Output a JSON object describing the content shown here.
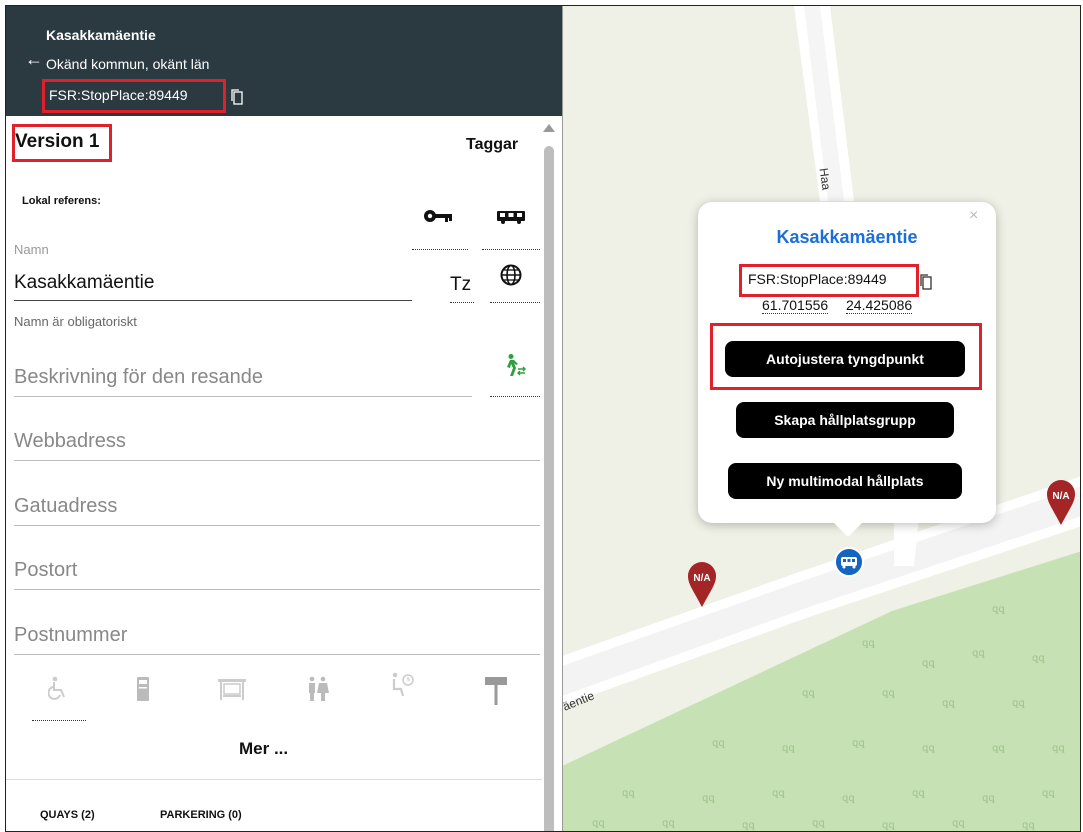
{
  "header": {
    "title": "Kasakkamäentie",
    "subtitle": "Okänd kommun, okänt län",
    "stop_id": "FSR:StopPlace:89449",
    "back_icon": "arrow-left-icon",
    "copy_icon": "copy-icon"
  },
  "form": {
    "version": "Version 1",
    "taggar": "Taggar",
    "local_ref_label": "Lokal referens:",
    "name_label": "Namn",
    "name_value": "Kasakkamäentie",
    "name_helper": "Namn är obligatoriskt",
    "tz_label": "Tz",
    "description_placeholder": "Beskrivning för den resande",
    "web_placeholder": "Webbadress",
    "street_placeholder": "Gatuadress",
    "city_placeholder": "Postort",
    "zip_placeholder": "Postnummer",
    "more": "Mer ...",
    "tabs": [
      "QUAYS (2)",
      "PARKERING (0)"
    ]
  },
  "popup": {
    "title": "Kasakkamäentie",
    "stop_id": "FSR:StopPlace:89449",
    "lat": "61.701556",
    "lon": "24.425086",
    "close": "×",
    "buttons": [
      "Autojustera tyngdpunkt",
      "Skapa hållplatsgrupp",
      "Ny multimodal hållplats"
    ]
  },
  "map": {
    "marker_label": "N/A",
    "street_1": "Haa",
    "street_2": "äentie"
  },
  "colors": {
    "header_bg": "#2b3a40",
    "highlight": "#e0202a",
    "popup_title": "#1b6fd8",
    "bus_marker": "#1565c0",
    "na_marker": "#a32525",
    "forest": "#c6e2b4"
  }
}
